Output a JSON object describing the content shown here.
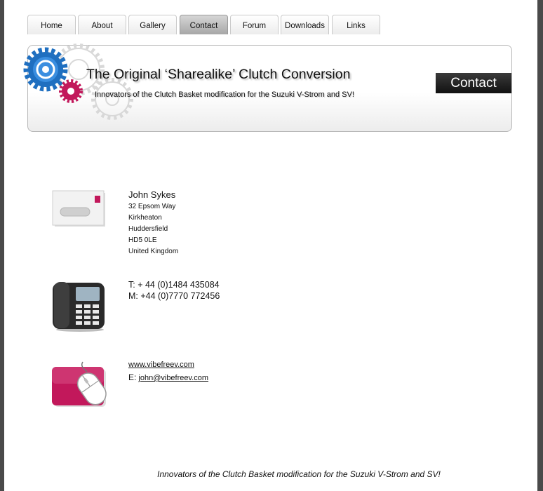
{
  "nav": {
    "tabs": [
      {
        "label": "Home"
      },
      {
        "label": "About"
      },
      {
        "label": "Gallery"
      },
      {
        "label": "Contact",
        "active": true
      },
      {
        "label": "Forum"
      },
      {
        "label": "Downloads"
      },
      {
        "label": "Links"
      }
    ]
  },
  "banner": {
    "title": "The Original ‘Sharealike’ Clutch Conversion",
    "tagline": "Innovators of the Clutch Basket modification for the Suzuki V-Strom and SV!",
    "page_badge": "Contact",
    "colors": {
      "gear_blue": "#1f6fc0",
      "gear_pink": "#c2185b",
      "badge_bg": "#1a1a1a"
    }
  },
  "contact": {
    "address": {
      "icon": "envelope-icon",
      "name": "John Sykes",
      "lines": [
        "32 Epsom Way",
        "Kirkheaton",
        "Huddersfield",
        "HD5 0LE",
        "United Kingdom"
      ]
    },
    "phone": {
      "icon": "telephone-icon",
      "telephone": "T: + 44 (0)1484 435084",
      "mobile": "M: +44 (0)7770 772456"
    },
    "web": {
      "icon": "mouse-icon",
      "website": "www.vibefreev.com",
      "email_label": "E:",
      "email": "john@vibefreev.com"
    }
  },
  "footer": {
    "text": "Innovators of the Clutch Basket modification for the Suzuki V-Strom and SV!"
  }
}
